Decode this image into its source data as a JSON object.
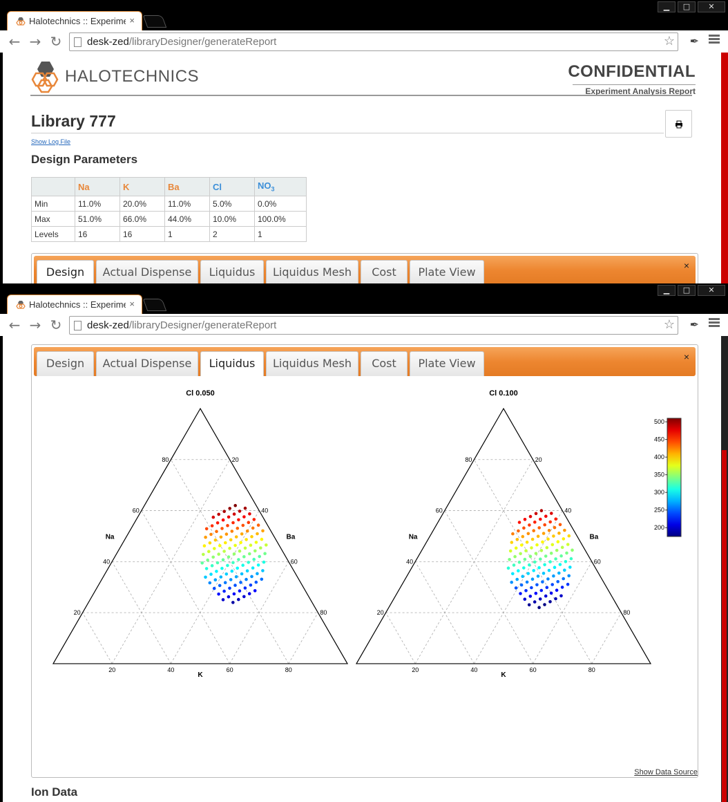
{
  "browser": {
    "tab_title": "Halotechnics :: Experiment",
    "tab_close": "×",
    "url_host": "desk-zed",
    "url_path": "/libraryDesigner/generateReport",
    "window_buttons": [
      "▁",
      "□",
      "✕"
    ]
  },
  "header": {
    "logo_text": "HALOTECHNICS",
    "confidential": "CONFIDENTIAL",
    "subtitle": "Experiment Analysis Report"
  },
  "library": {
    "title": "Library 777",
    "log_link": "Show Log File",
    "design_heading": "Design Parameters",
    "print_icon": "print-icon"
  },
  "design_table": {
    "headers": [
      "Na",
      "K",
      "Ba",
      "Cl",
      "NO"
    ],
    "header_subscript": "3",
    "header_colors": [
      "#e8873a",
      "#e8873a",
      "#e8873a",
      "#3c8fd8",
      "#3c8fd8"
    ],
    "rows": [
      {
        "label": "Min",
        "values": [
          "11.0%",
          "20.0%",
          "11.0%",
          "5.0%",
          "0.0%"
        ]
      },
      {
        "label": "Max",
        "values": [
          "51.0%",
          "66.0%",
          "44.0%",
          "10.0%",
          "100.0%"
        ]
      },
      {
        "label": "Levels",
        "values": [
          "16",
          "16",
          "1",
          "2",
          "1"
        ]
      }
    ]
  },
  "report_tabs": {
    "items": [
      "Design",
      "Actual Dispense",
      "Liquidus",
      "Liquidus Mesh",
      "Cost",
      "Plate View"
    ],
    "active_window1": "Design",
    "active_window2": "Liquidus",
    "close": "×"
  },
  "footer": {
    "show_source": "Show Data Source",
    "ion_heading": "Ion Data"
  },
  "chart_data": {
    "type": "scatter",
    "subtype": "ternary",
    "panels": [
      {
        "title": "Cl 0.050",
        "center": {
          "Na": 0.43,
          "K": 0.4,
          "Ba": 0.17
        }
      },
      {
        "title": "Cl 0.100",
        "center": {
          "Na": 0.41,
          "K": 0.42,
          "Ba": 0.17
        }
      }
    ],
    "axes": {
      "left": "Na",
      "right": "Ba",
      "bottom": "K"
    },
    "ticks": [
      20,
      40,
      60,
      80
    ],
    "grid": true,
    "colorbar": {
      "min": 175,
      "max": 510,
      "ticks": [
        200,
        250,
        300,
        350,
        400,
        450,
        500
      ]
    }
  }
}
